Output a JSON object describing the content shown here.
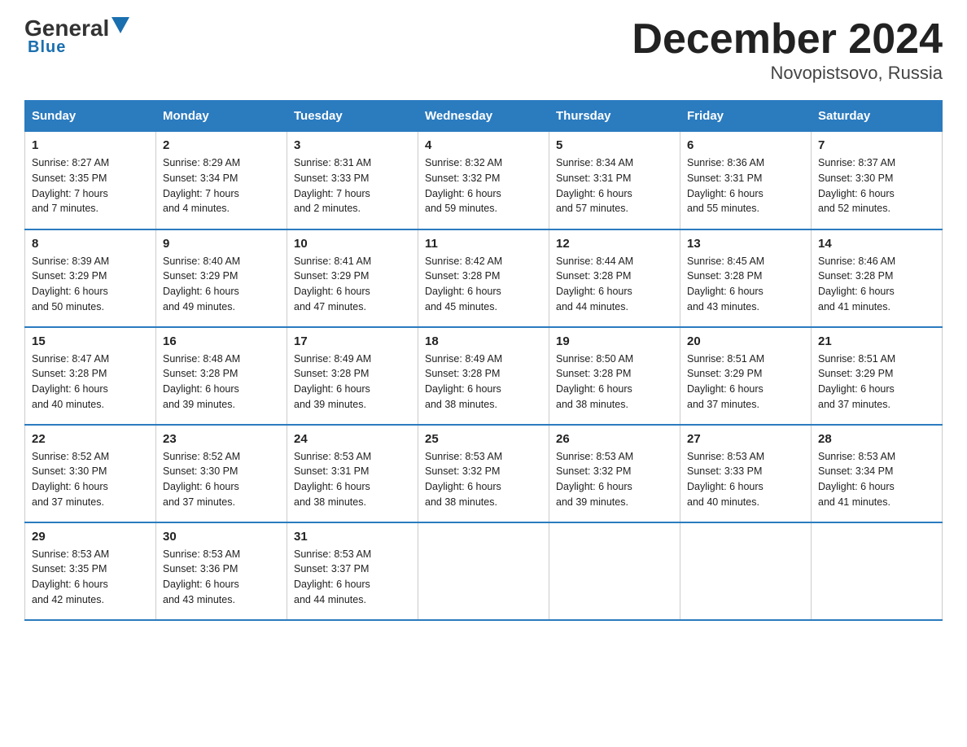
{
  "logo": {
    "general": "General",
    "blue": "Blue"
  },
  "title": "December 2024",
  "subtitle": "Novopistsovo, Russia",
  "days_of_week": [
    "Sunday",
    "Monday",
    "Tuesday",
    "Wednesday",
    "Thursday",
    "Friday",
    "Saturday"
  ],
  "weeks": [
    [
      {
        "day": "1",
        "info": "Sunrise: 8:27 AM\nSunset: 3:35 PM\nDaylight: 7 hours\nand 7 minutes."
      },
      {
        "day": "2",
        "info": "Sunrise: 8:29 AM\nSunset: 3:34 PM\nDaylight: 7 hours\nand 4 minutes."
      },
      {
        "day": "3",
        "info": "Sunrise: 8:31 AM\nSunset: 3:33 PM\nDaylight: 7 hours\nand 2 minutes."
      },
      {
        "day": "4",
        "info": "Sunrise: 8:32 AM\nSunset: 3:32 PM\nDaylight: 6 hours\nand 59 minutes."
      },
      {
        "day": "5",
        "info": "Sunrise: 8:34 AM\nSunset: 3:31 PM\nDaylight: 6 hours\nand 57 minutes."
      },
      {
        "day": "6",
        "info": "Sunrise: 8:36 AM\nSunset: 3:31 PM\nDaylight: 6 hours\nand 55 minutes."
      },
      {
        "day": "7",
        "info": "Sunrise: 8:37 AM\nSunset: 3:30 PM\nDaylight: 6 hours\nand 52 minutes."
      }
    ],
    [
      {
        "day": "8",
        "info": "Sunrise: 8:39 AM\nSunset: 3:29 PM\nDaylight: 6 hours\nand 50 minutes."
      },
      {
        "day": "9",
        "info": "Sunrise: 8:40 AM\nSunset: 3:29 PM\nDaylight: 6 hours\nand 49 minutes."
      },
      {
        "day": "10",
        "info": "Sunrise: 8:41 AM\nSunset: 3:29 PM\nDaylight: 6 hours\nand 47 minutes."
      },
      {
        "day": "11",
        "info": "Sunrise: 8:42 AM\nSunset: 3:28 PM\nDaylight: 6 hours\nand 45 minutes."
      },
      {
        "day": "12",
        "info": "Sunrise: 8:44 AM\nSunset: 3:28 PM\nDaylight: 6 hours\nand 44 minutes."
      },
      {
        "day": "13",
        "info": "Sunrise: 8:45 AM\nSunset: 3:28 PM\nDaylight: 6 hours\nand 43 minutes."
      },
      {
        "day": "14",
        "info": "Sunrise: 8:46 AM\nSunset: 3:28 PM\nDaylight: 6 hours\nand 41 minutes."
      }
    ],
    [
      {
        "day": "15",
        "info": "Sunrise: 8:47 AM\nSunset: 3:28 PM\nDaylight: 6 hours\nand 40 minutes."
      },
      {
        "day": "16",
        "info": "Sunrise: 8:48 AM\nSunset: 3:28 PM\nDaylight: 6 hours\nand 39 minutes."
      },
      {
        "day": "17",
        "info": "Sunrise: 8:49 AM\nSunset: 3:28 PM\nDaylight: 6 hours\nand 39 minutes."
      },
      {
        "day": "18",
        "info": "Sunrise: 8:49 AM\nSunset: 3:28 PM\nDaylight: 6 hours\nand 38 minutes."
      },
      {
        "day": "19",
        "info": "Sunrise: 8:50 AM\nSunset: 3:28 PM\nDaylight: 6 hours\nand 38 minutes."
      },
      {
        "day": "20",
        "info": "Sunrise: 8:51 AM\nSunset: 3:29 PM\nDaylight: 6 hours\nand 37 minutes."
      },
      {
        "day": "21",
        "info": "Sunrise: 8:51 AM\nSunset: 3:29 PM\nDaylight: 6 hours\nand 37 minutes."
      }
    ],
    [
      {
        "day": "22",
        "info": "Sunrise: 8:52 AM\nSunset: 3:30 PM\nDaylight: 6 hours\nand 37 minutes."
      },
      {
        "day": "23",
        "info": "Sunrise: 8:52 AM\nSunset: 3:30 PM\nDaylight: 6 hours\nand 37 minutes."
      },
      {
        "day": "24",
        "info": "Sunrise: 8:53 AM\nSunset: 3:31 PM\nDaylight: 6 hours\nand 38 minutes."
      },
      {
        "day": "25",
        "info": "Sunrise: 8:53 AM\nSunset: 3:32 PM\nDaylight: 6 hours\nand 38 minutes."
      },
      {
        "day": "26",
        "info": "Sunrise: 8:53 AM\nSunset: 3:32 PM\nDaylight: 6 hours\nand 39 minutes."
      },
      {
        "day": "27",
        "info": "Sunrise: 8:53 AM\nSunset: 3:33 PM\nDaylight: 6 hours\nand 40 minutes."
      },
      {
        "day": "28",
        "info": "Sunrise: 8:53 AM\nSunset: 3:34 PM\nDaylight: 6 hours\nand 41 minutes."
      }
    ],
    [
      {
        "day": "29",
        "info": "Sunrise: 8:53 AM\nSunset: 3:35 PM\nDaylight: 6 hours\nand 42 minutes."
      },
      {
        "day": "30",
        "info": "Sunrise: 8:53 AM\nSunset: 3:36 PM\nDaylight: 6 hours\nand 43 minutes."
      },
      {
        "day": "31",
        "info": "Sunrise: 8:53 AM\nSunset: 3:37 PM\nDaylight: 6 hours\nand 44 minutes."
      },
      {
        "day": "",
        "info": ""
      },
      {
        "day": "",
        "info": ""
      },
      {
        "day": "",
        "info": ""
      },
      {
        "day": "",
        "info": ""
      }
    ]
  ]
}
